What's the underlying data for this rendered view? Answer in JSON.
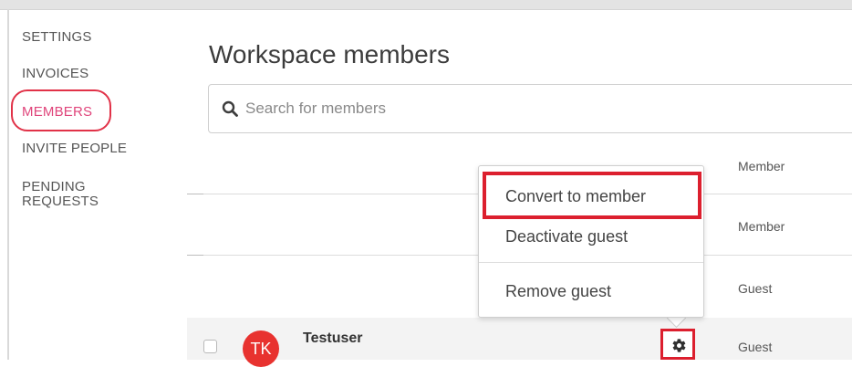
{
  "sidebar": {
    "items": [
      {
        "label": "SETTINGS"
      },
      {
        "label": "INVOICES"
      },
      {
        "label": "MEMBERS"
      },
      {
        "label": "INVITE PEOPLE"
      },
      {
        "label": "PENDING\nREQUESTS"
      }
    ],
    "active": "MEMBERS"
  },
  "main": {
    "title": "Workspace members",
    "search": {
      "placeholder": "Search for members",
      "value": ""
    },
    "rows": [
      {
        "role": "Member"
      },
      {
        "role": "Member"
      },
      {
        "role": "Guest"
      },
      {
        "avatar_initials": "TK",
        "name": "Testuser",
        "role": "Guest"
      }
    ]
  },
  "context_menu": {
    "items": [
      {
        "label": "Convert to member"
      },
      {
        "label": "Deactivate guest"
      },
      {
        "label": "Remove guest"
      }
    ]
  },
  "colors": {
    "accent_pink": "#e0457b",
    "highlight_red": "#dc1f2e",
    "avatar_red": "#e8322f"
  },
  "icons": {
    "search": "search-icon",
    "settings": "gear-icon"
  }
}
